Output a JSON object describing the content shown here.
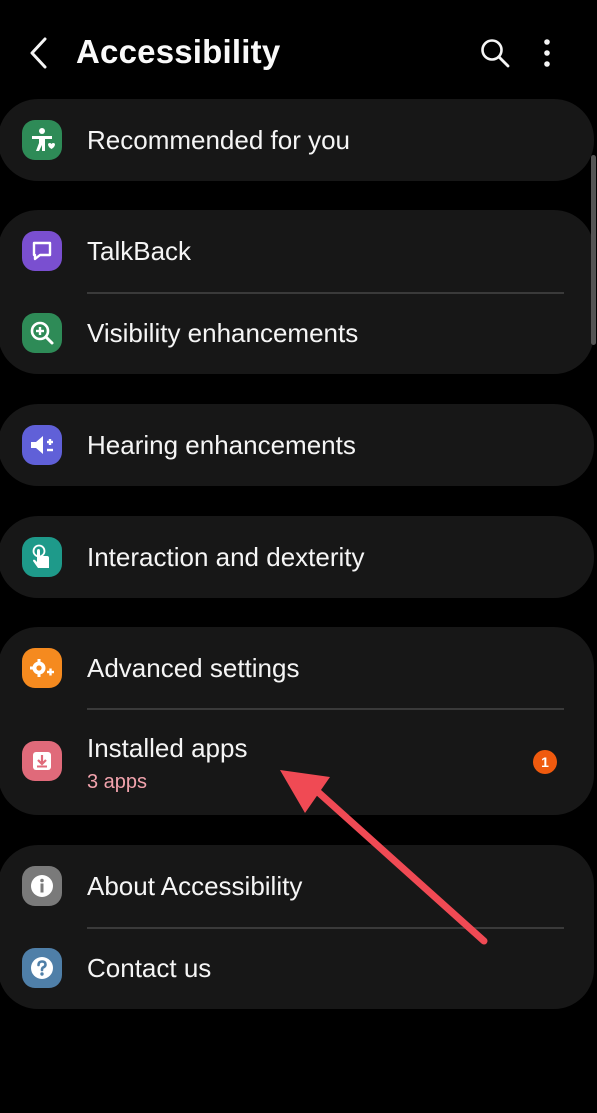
{
  "header": {
    "title": "Accessibility",
    "back_icon": "chevron-left-icon",
    "search_icon": "search-icon",
    "more_icon": "more-vertical-icon"
  },
  "items": {
    "recommended": {
      "label": "Recommended for you",
      "icon": "accessibility-person-icon",
      "color": "#2e8b57"
    },
    "talkback": {
      "label": "TalkBack",
      "icon": "talkback-message-icon",
      "color": "#7a4fd0"
    },
    "visibility": {
      "label": "Visibility enhancements",
      "icon": "magnifier-plus-icon",
      "color": "#2e8b57"
    },
    "hearing": {
      "label": "Hearing enhancements",
      "icon": "speaker-plus-icon",
      "color": "#6060d8"
    },
    "interaction": {
      "label": "Interaction and dexterity",
      "icon": "touch-hand-icon",
      "color": "#1e9a8a"
    },
    "advanced": {
      "label": "Advanced settings",
      "icon": "gears-plus-icon",
      "color": "#f58a1f"
    },
    "installed": {
      "label": "Installed apps",
      "sub": "3 apps",
      "badge": "1",
      "icon": "download-tray-icon",
      "color": "#e06a7a"
    },
    "about": {
      "label": "About Accessibility",
      "icon": "info-icon",
      "color": "#7a7a7a"
    },
    "contact": {
      "label": "Contact us",
      "icon": "question-icon",
      "color": "#4f7fa8"
    }
  },
  "colors": {
    "background": "#000000",
    "card": "#171717",
    "annotation_arrow": "#f04a54",
    "badge": "#f05a0e",
    "subtext": "#f2a3ad"
  }
}
